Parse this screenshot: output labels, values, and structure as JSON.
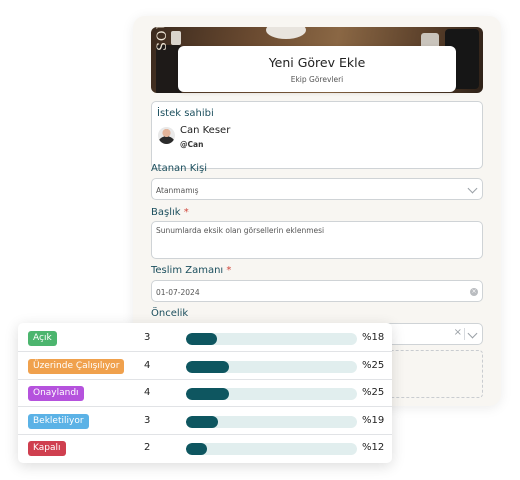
{
  "header": {
    "title": "Yeni Görev Ekle",
    "subtitle": "Ekip Görevleri",
    "image_text": "SOU"
  },
  "owner": {
    "label": "İstek sahibi",
    "name": "Can Keser",
    "handle": "@Can"
  },
  "assignee": {
    "label": "Atanan Kişi",
    "value": "Atanmamış"
  },
  "title_field": {
    "label": "Başlık",
    "required_mark": "*",
    "value": "Sunumlarda eksik olan görsellerin eklenmesi"
  },
  "due_date": {
    "label": "Teslim Zamanı",
    "required_mark": "*",
    "value": "01-07-2024"
  },
  "priority": {
    "label": "Öncelik"
  },
  "statuses": [
    {
      "label": "Açık",
      "count": "3",
      "percent_text": "%18",
      "fill": 0.18,
      "color": "#4cb56e"
    },
    {
      "label": "Üzerinde Çalışılıyor",
      "count": "4",
      "percent_text": "%25",
      "fill": 0.25,
      "color": "#f0a14d"
    },
    {
      "label": "Onaylandı",
      "count": "4",
      "percent_text": "%25",
      "fill": 0.25,
      "color": "#b552dd"
    },
    {
      "label": "Bekletiliyor",
      "count": "3",
      "percent_text": "%19",
      "fill": 0.19,
      "color": "#5bb2e6"
    },
    {
      "label": "Kapalı",
      "count": "2",
      "percent_text": "%12",
      "fill": 0.12,
      "color": "#cf3f4f"
    }
  ],
  "colors": {
    "accent": "#0e5660",
    "label": "#1c4f5e",
    "required": "#d0463b",
    "track": "#e1eeee"
  }
}
